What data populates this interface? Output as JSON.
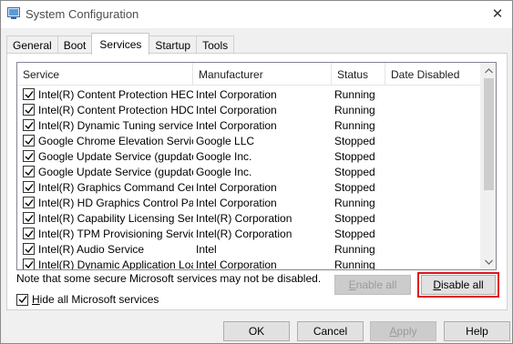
{
  "window": {
    "title": "System Configuration",
    "close_glyph": "✕"
  },
  "tabs": [
    {
      "label": "General"
    },
    {
      "label": "Boot"
    },
    {
      "label": "Services"
    },
    {
      "label": "Startup"
    },
    {
      "label": "Tools"
    }
  ],
  "active_tab": "Services",
  "columns": {
    "service": "Service",
    "manufacturer": "Manufacturer",
    "status": "Status",
    "date_disabled": "Date Disabled"
  },
  "services": [
    {
      "name": "Intel(R) Content Protection HEC...",
      "manufacturer": "Intel Corporation",
      "status": "Running",
      "date_disabled": "",
      "checked": true
    },
    {
      "name": "Intel(R) Content Protection HDC...",
      "manufacturer": "Intel Corporation",
      "status": "Running",
      "date_disabled": "",
      "checked": true
    },
    {
      "name": "Intel(R) Dynamic Tuning service",
      "manufacturer": "Intel Corporation",
      "status": "Running",
      "date_disabled": "",
      "checked": true
    },
    {
      "name": "Google Chrome Elevation Servic...",
      "manufacturer": "Google LLC",
      "status": "Stopped",
      "date_disabled": "",
      "checked": true
    },
    {
      "name": "Google Update Service (gupdate)",
      "manufacturer": "Google Inc.",
      "status": "Stopped",
      "date_disabled": "",
      "checked": true
    },
    {
      "name": "Google Update Service (gupdatem)",
      "manufacturer": "Google Inc.",
      "status": "Stopped",
      "date_disabled": "",
      "checked": true
    },
    {
      "name": "Intel(R) Graphics Command Cen...",
      "manufacturer": "Intel Corporation",
      "status": "Stopped",
      "date_disabled": "",
      "checked": true
    },
    {
      "name": "Intel(R) HD Graphics Control Pa...",
      "manufacturer": "Intel Corporation",
      "status": "Running",
      "date_disabled": "",
      "checked": true
    },
    {
      "name": "Intel(R) Capability Licensing Ser...",
      "manufacturer": "Intel(R) Corporation",
      "status": "Stopped",
      "date_disabled": "",
      "checked": true
    },
    {
      "name": "Intel(R) TPM Provisioning Service",
      "manufacturer": "Intel(R) Corporation",
      "status": "Stopped",
      "date_disabled": "",
      "checked": true
    },
    {
      "name": "Intel(R) Audio Service",
      "manufacturer": "Intel",
      "status": "Running",
      "date_disabled": "",
      "checked": true
    },
    {
      "name": "Intel(R) Dynamic Application Loa...",
      "manufacturer": "Intel Corporation",
      "status": "Running",
      "date_disabled": "",
      "checked": true
    }
  ],
  "note": "Note that some secure Microsoft services may not be disabled.",
  "buttons": {
    "enable_all_prefix": "",
    "enable_all_key": "E",
    "enable_all_rest": "nable all",
    "disable_all_prefix": "",
    "disable_all_key": "D",
    "disable_all_rest": "isable all"
  },
  "hide_ms": {
    "prefix": "",
    "key": "H",
    "rest": "ide all Microsoft services",
    "checked": true
  },
  "footer": {
    "ok": "OK",
    "cancel": "Cancel",
    "apply_prefix": "",
    "apply_key": "A",
    "apply_rest": "pply",
    "help": "Help"
  },
  "colors": {
    "highlight": "#e0141e",
    "window_bg": "#f0f0f0"
  }
}
